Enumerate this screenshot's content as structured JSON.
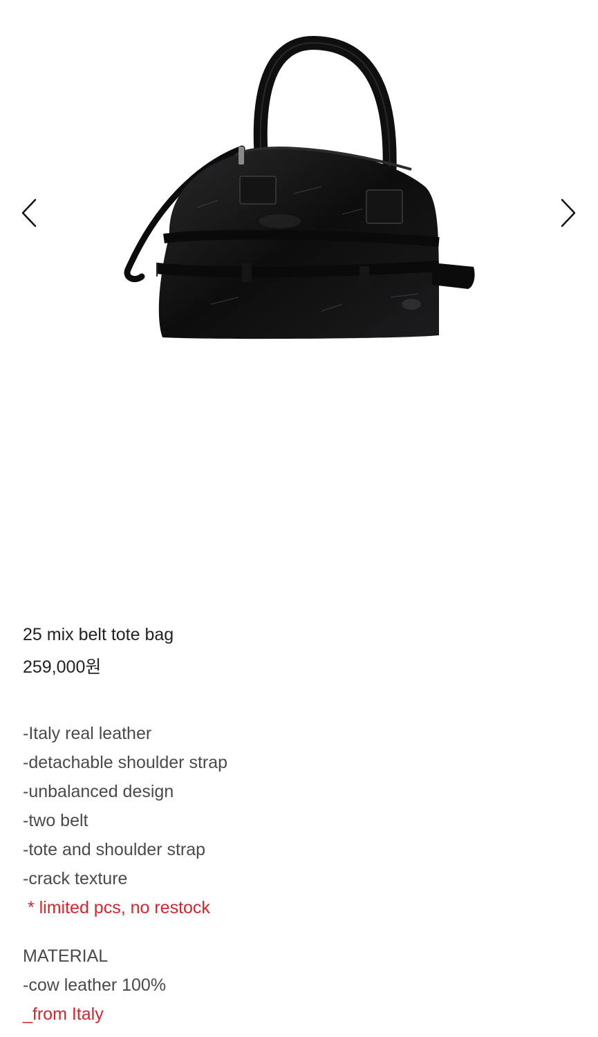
{
  "gallery": {
    "prev_icon": "chevron-left-icon",
    "next_icon": "chevron-right-icon",
    "image": "black crinkled leather tote bag with two belts and detachable shoulder strap"
  },
  "product": {
    "name": "25 mix belt tote bag",
    "price": "259,000원"
  },
  "description": {
    "features": [
      "-Italy real leather",
      "-detachable shoulder strap",
      "-unbalanced design",
      "-two belt",
      "-tote and shoulder strap",
      "-crack texture"
    ],
    "notice": " * limited pcs, no restock",
    "material_heading": "MATERIAL",
    "material_value": "-cow leather 100%",
    "origin": "_from Italy"
  },
  "colors": {
    "text": "#222222",
    "body_text": "#4a4a4a",
    "accent_red": "#d5262b"
  }
}
